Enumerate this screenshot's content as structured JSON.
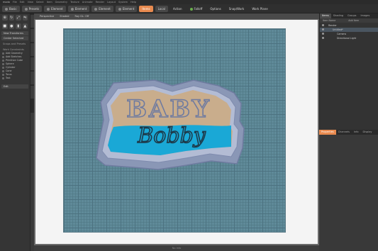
{
  "app": {
    "title": "modo",
    "menu": [
      "File",
      "Edit",
      "View",
      "Select",
      "Item",
      "Geometry",
      "Texture",
      "Animate",
      "Render",
      "Layout",
      "System",
      "Help"
    ]
  },
  "toolbar": {
    "left_buttons": [
      "Basic",
      "Presets",
      "Element",
      "Element",
      "Element",
      "Element"
    ],
    "center_buttons": [
      {
        "label": "Items",
        "active": true
      },
      {
        "label": "Local",
        "active": false
      },
      {
        "label": "Action",
        "active": false
      },
      {
        "label": "Falloff",
        "active": false
      },
      {
        "label": "Options",
        "active": false
      },
      {
        "label": "Snap/Work",
        "active": false
      },
      {
        "label": "Work Plane",
        "active": false
      }
    ],
    "layout_tabs": [
      "Model",
      "Topology",
      "UV/Edit",
      "Paint",
      "Layout",
      "Setup",
      "Animate",
      "Render",
      "Scripting",
      "Schematic Fusion"
    ],
    "accent": "#e88a4f"
  },
  "left_panel": {
    "mode_buttons": [
      "New Transforms",
      "Center Selected"
    ],
    "sections": [
      {
        "title": "Snaps and Presets",
        "items": []
      },
      {
        "title": "Work Constraints",
        "items": [
          "Add Geometry",
          "Add Sketches",
          "Primitive Cube",
          "Sphere",
          "Cylinder",
          "Cone",
          "Torus",
          "Text"
        ]
      }
    ],
    "footer": "Edit"
  },
  "viewport": {
    "header": [
      "Perspective",
      "Shaded",
      "Ray GL: Off"
    ],
    "footer": "No Info",
    "model_text": {
      "line1": "BABY",
      "line2": "Bobby"
    },
    "colors": {
      "paper": "#f4f4f4",
      "grid": "#5f8a99",
      "cutter_outline": "#8a97b6",
      "cutter_tan": "#c9ad8c",
      "cutter_blue": "#1aa8d6"
    }
  },
  "right_panel": {
    "tabs": [
      {
        "label": "Items",
        "active": true
      },
      {
        "label": "Shading",
        "active": false
      },
      {
        "label": "Groups",
        "active": false
      },
      {
        "label": "Images",
        "active": false
      }
    ],
    "columns": [
      "Item Name",
      "Add Item"
    ],
    "tree": [
      {
        "label": "Render",
        "indent": 6,
        "selected": false
      },
      {
        "label": "Untitled*",
        "indent": 12,
        "selected": true
      },
      {
        "label": "Camera",
        "indent": 18,
        "selected": false
      },
      {
        "label": "Directional Light",
        "indent": 18,
        "selected": false
      }
    ],
    "bottom_tabs": [
      {
        "label": "Properties",
        "active": true
      },
      {
        "label": "Channels",
        "active": false
      },
      {
        "label": "Info",
        "active": false
      },
      {
        "label": "Display",
        "active": false
      }
    ]
  }
}
